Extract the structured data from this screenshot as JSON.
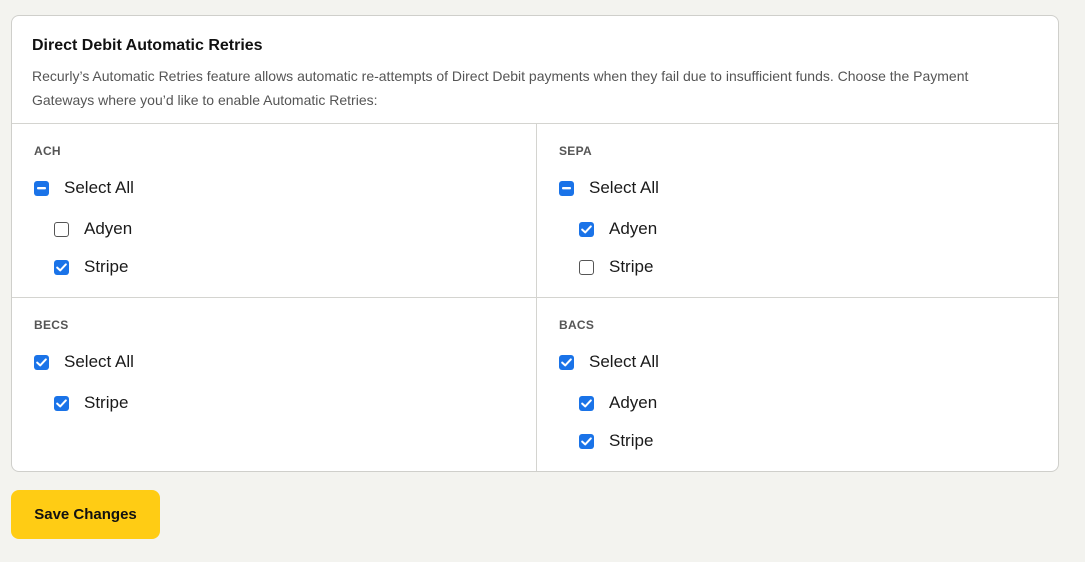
{
  "header": {
    "title": "Direct Debit Automatic Retries",
    "description": "Recurly’s Automatic Retries feature allows automatic re-attempts of Direct Debit payments when they fail due to insufficient funds. Choose the Payment Gateways where you’d like to enable Automatic Retries:"
  },
  "sections": [
    {
      "label": "ACH",
      "select_all": {
        "label": "Select All",
        "state": "indeterminate"
      },
      "items": [
        {
          "label": "Adyen",
          "state": "unchecked"
        },
        {
          "label": "Stripe",
          "state": "checked"
        }
      ]
    },
    {
      "label": "SEPA",
      "select_all": {
        "label": "Select All",
        "state": "indeterminate"
      },
      "items": [
        {
          "label": "Adyen",
          "state": "checked"
        },
        {
          "label": "Stripe",
          "state": "unchecked"
        }
      ]
    },
    {
      "label": "BECS",
      "select_all": {
        "label": "Select All",
        "state": "checked"
      },
      "items": [
        {
          "label": "Stripe",
          "state": "checked"
        }
      ]
    },
    {
      "label": "BACS",
      "select_all": {
        "label": "Select All",
        "state": "checked"
      },
      "items": [
        {
          "label": "Adyen",
          "state": "checked"
        },
        {
          "label": "Stripe",
          "state": "checked"
        }
      ]
    }
  ],
  "footer": {
    "save_label": "Save Changes"
  },
  "colors": {
    "checkbox_accent": "#1a73e8",
    "save_button": "#ffcc14"
  }
}
